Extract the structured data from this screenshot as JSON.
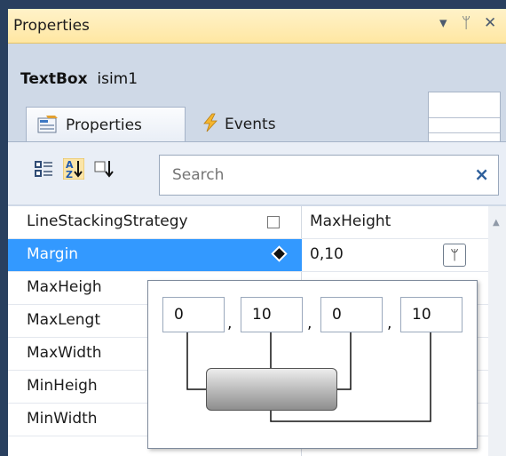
{
  "panel": {
    "title": "Properties",
    "buttons": {
      "dropdown": "▾",
      "pin": "ᛘ",
      "close": "✕"
    }
  },
  "object": {
    "type": "TextBox",
    "name": "isim1"
  },
  "tabs": [
    {
      "label": "Properties",
      "active": true
    },
    {
      "label": "Events",
      "active": false
    }
  ],
  "toolbar": {
    "search_placeholder": "Search",
    "clear": "×"
  },
  "properties": [
    {
      "name": "LineStackingStrategy",
      "value": "MaxHeight"
    },
    {
      "name": "Margin",
      "value": "0,10",
      "selected": true
    },
    {
      "name": "MaxHeigh",
      "value": ""
    },
    {
      "name": "MaxLengt",
      "value": ""
    },
    {
      "name": "MaxWidth",
      "value": ""
    },
    {
      "name": "MinHeigh",
      "value": ""
    },
    {
      "name": "MinWidth",
      "value": ""
    }
  ],
  "margin_editor": {
    "values": [
      "0",
      "10",
      "0",
      "10"
    ],
    "separator": ","
  },
  "colors": {
    "selection": "#3399ff",
    "titlebar": "#ffe7a2",
    "frame": "#cfd9e7"
  }
}
